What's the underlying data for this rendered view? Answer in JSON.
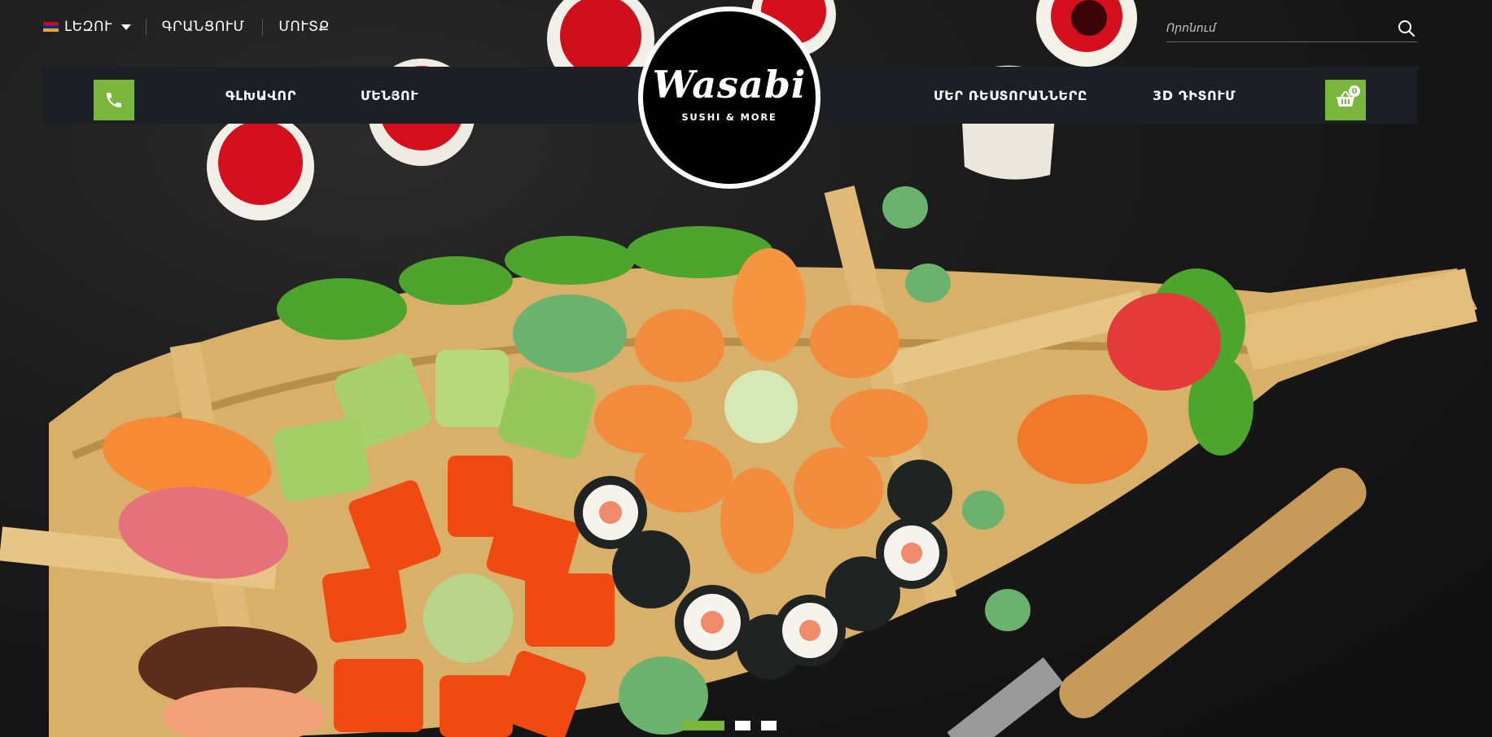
{
  "topbar": {
    "language_label": "ԼԵԶՈՒ",
    "register_label": "ԳՐԱՆՑՈՒՄ",
    "login_label": "ՄՈՒՏՔ"
  },
  "search": {
    "placeholder": "Որոնում"
  },
  "nav": {
    "items": [
      {
        "label": "ԳԼԽԱՎՈՐ"
      },
      {
        "label": "ՄԵՆՅՈՒ"
      },
      {
        "label": "ՄԵՐ ՌԵՍՏՈՐԱՆՆԵՐԸ"
      },
      {
        "label": "3D ԴԻՏՈՒՄ"
      }
    ],
    "cart_count": "0"
  },
  "logo": {
    "title": "Wasabi",
    "subtitle": "SUSHI & MORE"
  },
  "slider": {
    "slides": 3,
    "active_index": 0
  },
  "colors": {
    "accent": "#7ab53c",
    "navbar": "#1c1f25"
  },
  "icons": [
    "flag-armenia-icon",
    "chevron-down-icon",
    "search-icon",
    "phone-icon",
    "cart-icon"
  ]
}
